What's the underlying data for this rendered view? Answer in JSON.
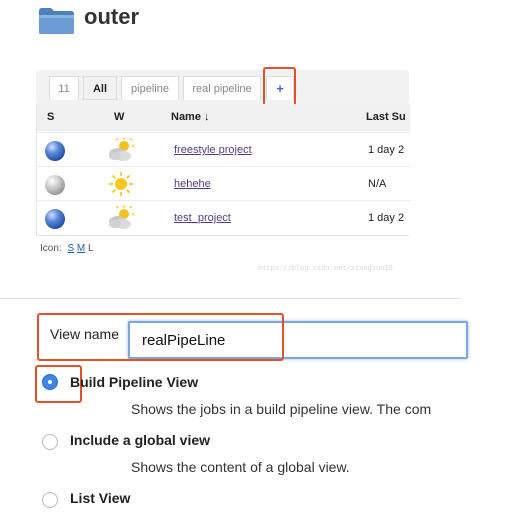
{
  "header": {
    "title": "outer",
    "folder_icon": "folder-icon"
  },
  "tabs": [
    {
      "label": "11"
    },
    {
      "label": "All"
    },
    {
      "label": "pipeline"
    },
    {
      "label": "real pipeline"
    },
    {
      "label": "+"
    }
  ],
  "active_tab": "All",
  "table": {
    "columns": [
      "S",
      "W",
      "Name ↓",
      "Last Su"
    ],
    "rows": [
      {
        "status": "blue",
        "weather": "cloudy-sun",
        "name": "freestyle project",
        "last": "1 day 2"
      },
      {
        "status": "grey",
        "weather": "sunny",
        "name": "hehehe",
        "last": "N/A"
      },
      {
        "status": "blue",
        "weather": "cloudy-sun",
        "name": "test_project",
        "last": "1 day 2"
      }
    ]
  },
  "icon_size": {
    "label": "Icon:",
    "options": [
      "S",
      "M",
      "L"
    ]
  },
  "watermark": "https://blog.csdn.net/xiangsun10",
  "form": {
    "view_name_label": "View name",
    "view_name_value": "realPipeLine",
    "options": [
      {
        "title": "Build Pipeline View",
        "desc": "Shows the jobs in a build pipeline view. The com",
        "checked": true
      },
      {
        "title": "Include a global view",
        "desc": "Shows the content of a global view.",
        "checked": false
      },
      {
        "title": "List View",
        "desc": "",
        "checked": false
      }
    ]
  },
  "colors": {
    "highlight": "#e0512a",
    "link": "#5b3a8a",
    "radio_selected": "#3d86e6",
    "input_focus": "#7aa7e0"
  }
}
